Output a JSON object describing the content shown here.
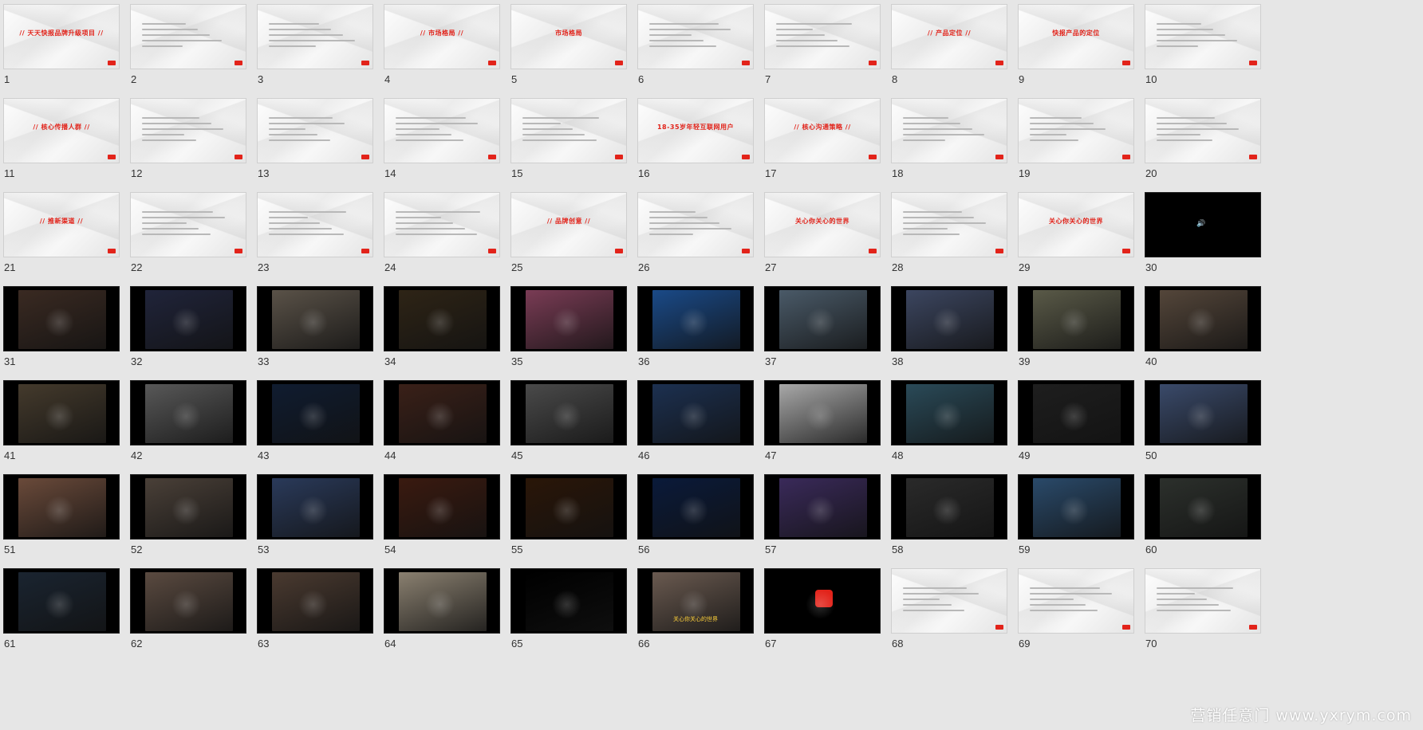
{
  "watermark": "营销任意门 www.yxrym.com",
  "slides": [
    {
      "n": "1",
      "t": "light",
      "title": "// 天天快报品牌升级项目 //"
    },
    {
      "n": "2",
      "t": "light",
      "title": ""
    },
    {
      "n": "3",
      "t": "light",
      "title": ""
    },
    {
      "n": "4",
      "t": "light",
      "title": "// 市场格局 //"
    },
    {
      "n": "5",
      "t": "light",
      "title": "市场格局"
    },
    {
      "n": "6",
      "t": "light",
      "title": ""
    },
    {
      "n": "7",
      "t": "light",
      "title": ""
    },
    {
      "n": "8",
      "t": "light",
      "title": "// 产品定位 //"
    },
    {
      "n": "9",
      "t": "light",
      "title": "快报产品的定位"
    },
    {
      "n": "10",
      "t": "light",
      "title": ""
    },
    {
      "n": "11",
      "t": "light",
      "title": "// 核心传播人群 //"
    },
    {
      "n": "12",
      "t": "light",
      "title": ""
    },
    {
      "n": "13",
      "t": "light",
      "title": ""
    },
    {
      "n": "14",
      "t": "light",
      "title": ""
    },
    {
      "n": "15",
      "t": "light",
      "title": ""
    },
    {
      "n": "16",
      "t": "light",
      "title": "18-35岁年轻互联网用户"
    },
    {
      "n": "17",
      "t": "light",
      "title": "// 核心沟通策略 //"
    },
    {
      "n": "18",
      "t": "light",
      "title": ""
    },
    {
      "n": "19",
      "t": "light",
      "title": ""
    },
    {
      "n": "20",
      "t": "light",
      "title": ""
    },
    {
      "n": "21",
      "t": "light",
      "title": "// 推新渠道 //"
    },
    {
      "n": "22",
      "t": "light",
      "title": ""
    },
    {
      "n": "23",
      "t": "light",
      "title": ""
    },
    {
      "n": "24",
      "t": "light",
      "title": ""
    },
    {
      "n": "25",
      "t": "light",
      "title": "// 品牌创意 //"
    },
    {
      "n": "26",
      "t": "light",
      "title": ""
    },
    {
      "n": "27",
      "t": "light",
      "title": "关心你关心的世界"
    },
    {
      "n": "28",
      "t": "light",
      "title": ""
    },
    {
      "n": "29",
      "t": "light",
      "title": "关心你关心的世界"
    },
    {
      "n": "30",
      "t": "dark",
      "title": "",
      "speaker": true
    },
    {
      "n": "31",
      "t": "dark",
      "title": "",
      "c": "#3a2a22"
    },
    {
      "n": "32",
      "t": "dark",
      "title": "",
      "c": "#20243a"
    },
    {
      "n": "33",
      "t": "dark",
      "title": "",
      "c": "#5a5248"
    },
    {
      "n": "34",
      "t": "dark",
      "title": "",
      "c": "#2e2416"
    },
    {
      "n": "35",
      "t": "dark",
      "title": "",
      "c": "#7a3c55"
    },
    {
      "n": "36",
      "t": "dark",
      "title": "",
      "c": "#1a4a88"
    },
    {
      "n": "37",
      "t": "dark",
      "title": "",
      "c": "#4a5a68"
    },
    {
      "n": "38",
      "t": "dark",
      "title": "",
      "c": "#3c4660"
    },
    {
      "n": "39",
      "t": "dark",
      "title": "",
      "c": "#5a5a48"
    },
    {
      "n": "40",
      "t": "dark",
      "title": "",
      "c": "#54463a"
    },
    {
      "n": "41",
      "t": "dark",
      "title": "",
      "c": "#443a2c"
    },
    {
      "n": "42",
      "t": "dark",
      "title": "",
      "c": "#585858"
    },
    {
      "n": "43",
      "t": "dark",
      "title": "",
      "c": "#101c30"
    },
    {
      "n": "44",
      "t": "dark",
      "title": "",
      "c": "#3a2018"
    },
    {
      "n": "45",
      "t": "dark",
      "title": "",
      "c": "#4a4a4a"
    },
    {
      "n": "46",
      "t": "dark",
      "title": "",
      "c": "#1c3050"
    },
    {
      "n": "47",
      "t": "dark",
      "title": "",
      "c": "#a8a8a8"
    },
    {
      "n": "48",
      "t": "dark",
      "title": "",
      "c": "#2a4a58"
    },
    {
      "n": "49",
      "t": "dark",
      "title": "",
      "c": "#1e1e1e"
    },
    {
      "n": "50",
      "t": "dark",
      "title": "",
      "c": "#3a4a6a"
    },
    {
      "n": "51",
      "t": "dark",
      "title": "",
      "c": "#6a4a3a"
    },
    {
      "n": "52",
      "t": "dark",
      "title": "",
      "c": "#4a4038"
    },
    {
      "n": "53",
      "t": "dark",
      "title": "",
      "c": "#2a3a5a"
    },
    {
      "n": "54",
      "t": "dark",
      "title": "",
      "c": "#3a1a10"
    },
    {
      "n": "55",
      "t": "dark",
      "title": "",
      "c": "#2a1608"
    },
    {
      "n": "56",
      "t": "dark",
      "title": "",
      "c": "#0a1a3a"
    },
    {
      "n": "57",
      "t": "dark",
      "title": "",
      "c": "#3a2a5a"
    },
    {
      "n": "58",
      "t": "dark",
      "title": "",
      "c": "#2a2a2a"
    },
    {
      "n": "59",
      "t": "dark",
      "title": "",
      "c": "#2a4a6a"
    },
    {
      "n": "60",
      "t": "dark",
      "title": "",
      "c": "#2c302c"
    },
    {
      "n": "61",
      "t": "dark",
      "title": "",
      "c": "#1a2430"
    },
    {
      "n": "62",
      "t": "dark",
      "title": "",
      "c": "#5a4a40"
    },
    {
      "n": "63",
      "t": "dark",
      "title": "",
      "c": "#4a3a30"
    },
    {
      "n": "64",
      "t": "dark",
      "title": "",
      "c": "#8a8070"
    },
    {
      "n": "65",
      "t": "dark",
      "title": "",
      "c": "#000000"
    },
    {
      "n": "66",
      "t": "dark",
      "title": "关心你关心的世界",
      "c": "#6a5a50"
    },
    {
      "n": "67",
      "t": "dark",
      "title": "",
      "logo": true,
      "c": "#000000"
    },
    {
      "n": "68",
      "t": "light",
      "title": ""
    },
    {
      "n": "69",
      "t": "light",
      "title": ""
    },
    {
      "n": "70",
      "t": "light",
      "title": ""
    }
  ]
}
